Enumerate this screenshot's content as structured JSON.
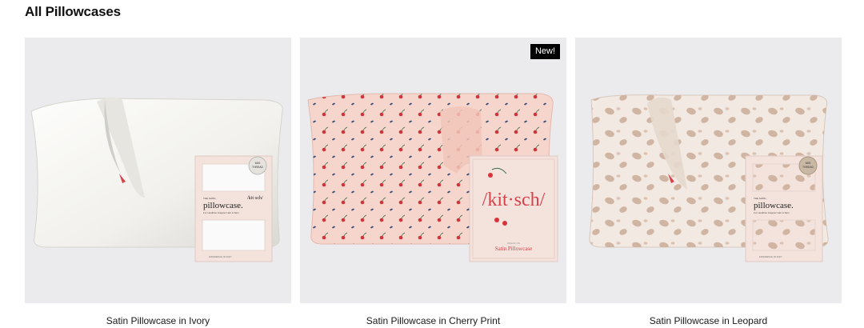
{
  "section": {
    "title": "All Pillowcases"
  },
  "products": [
    {
      "name": "Satin Pillowcase in Ivory",
      "badge": "",
      "box": {
        "brand": "/kit·sch/",
        "eyebrow": "THE SATIN",
        "title": "pillowcase.",
        "tagline": "For Healthier Happier Hair & Skin",
        "thread": "600\nTHREAD\nCOUNT",
        "footer": "EXPERIENCE: 00 SOFT",
        "count": "1"
      }
    },
    {
      "name": "Satin Pillowcase in Cherry Print",
      "badge": "New!",
      "box": {
        "brand": "/kit·sch/",
        "title": "Satin Pillowcase",
        "eyebrow": "DREAM ON"
      }
    },
    {
      "name": "Satin Pillowcase in Leopard",
      "badge": "",
      "box": {
        "brand": "/kit·sch/",
        "eyebrow": "THE SATIN",
        "title": "pillowcase.",
        "tagline": "For Healthier Happier Hair & Skin",
        "thread": "600\nTHREAD\nCOUNT",
        "footer": "EXPERIENCE: 00 SOFT",
        "count": "1"
      }
    }
  ],
  "colors": {
    "ivory": "#f7f6f2",
    "cherry_bg": "#f6d6cc",
    "leopard_bg": "#f1e9e2",
    "leopard_spot": "#d1b5a3",
    "box": "#f4e2dc"
  }
}
